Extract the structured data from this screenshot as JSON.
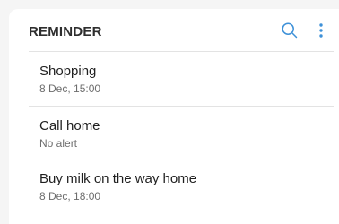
{
  "toolbar": {
    "title": "REMINDER",
    "search_icon": "search-icon",
    "more_icon": "more-vertical-icon",
    "accent_color": "#3e91d8"
  },
  "reminders": [
    {
      "title": "Shopping",
      "subtitle": "8 Dec, 15:00"
    },
    {
      "title": "Call home",
      "subtitle": "No alert"
    },
    {
      "title": "Buy milk on the way home",
      "subtitle": "8 Dec, 18:00"
    }
  ]
}
